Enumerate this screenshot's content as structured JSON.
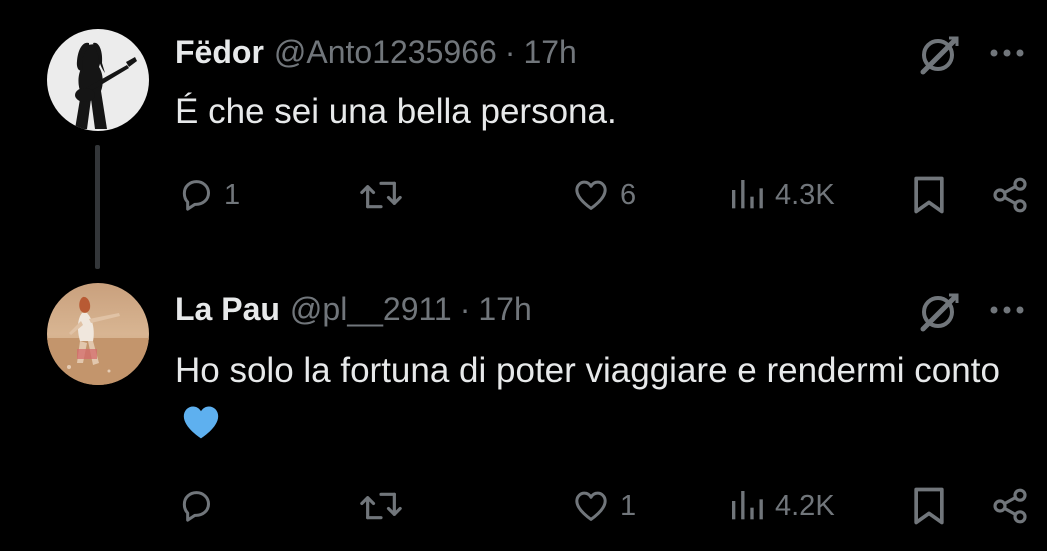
{
  "tweets": [
    {
      "display_name": "Fëdor",
      "handle": "@Anto1235966",
      "separator": "·",
      "time": "17h",
      "text": "É che sei una bella persona.",
      "emoji": "",
      "replies": "1",
      "retweets": "",
      "likes": "6",
      "views": "4.3K"
    },
    {
      "display_name": "La Pau",
      "handle": "@pl__2911",
      "separator": "·",
      "time": "17h",
      "text": "Ho solo la fortuna di poter viaggiare e rendermi conto",
      "emoji": "💙",
      "replies": "",
      "retweets": "",
      "likes": "1",
      "views": "4.2K"
    }
  ],
  "colors": {
    "background": "#000000",
    "primary_text": "#e7e9ea",
    "secondary_text": "#71767b",
    "thread_line": "#333639",
    "heart_blue": "#5eb0ef"
  },
  "icons": [
    "grok-icon",
    "more-icon",
    "reply-icon",
    "retweet-icon",
    "like-icon",
    "views-icon",
    "bookmark-icon",
    "share-icon"
  ]
}
